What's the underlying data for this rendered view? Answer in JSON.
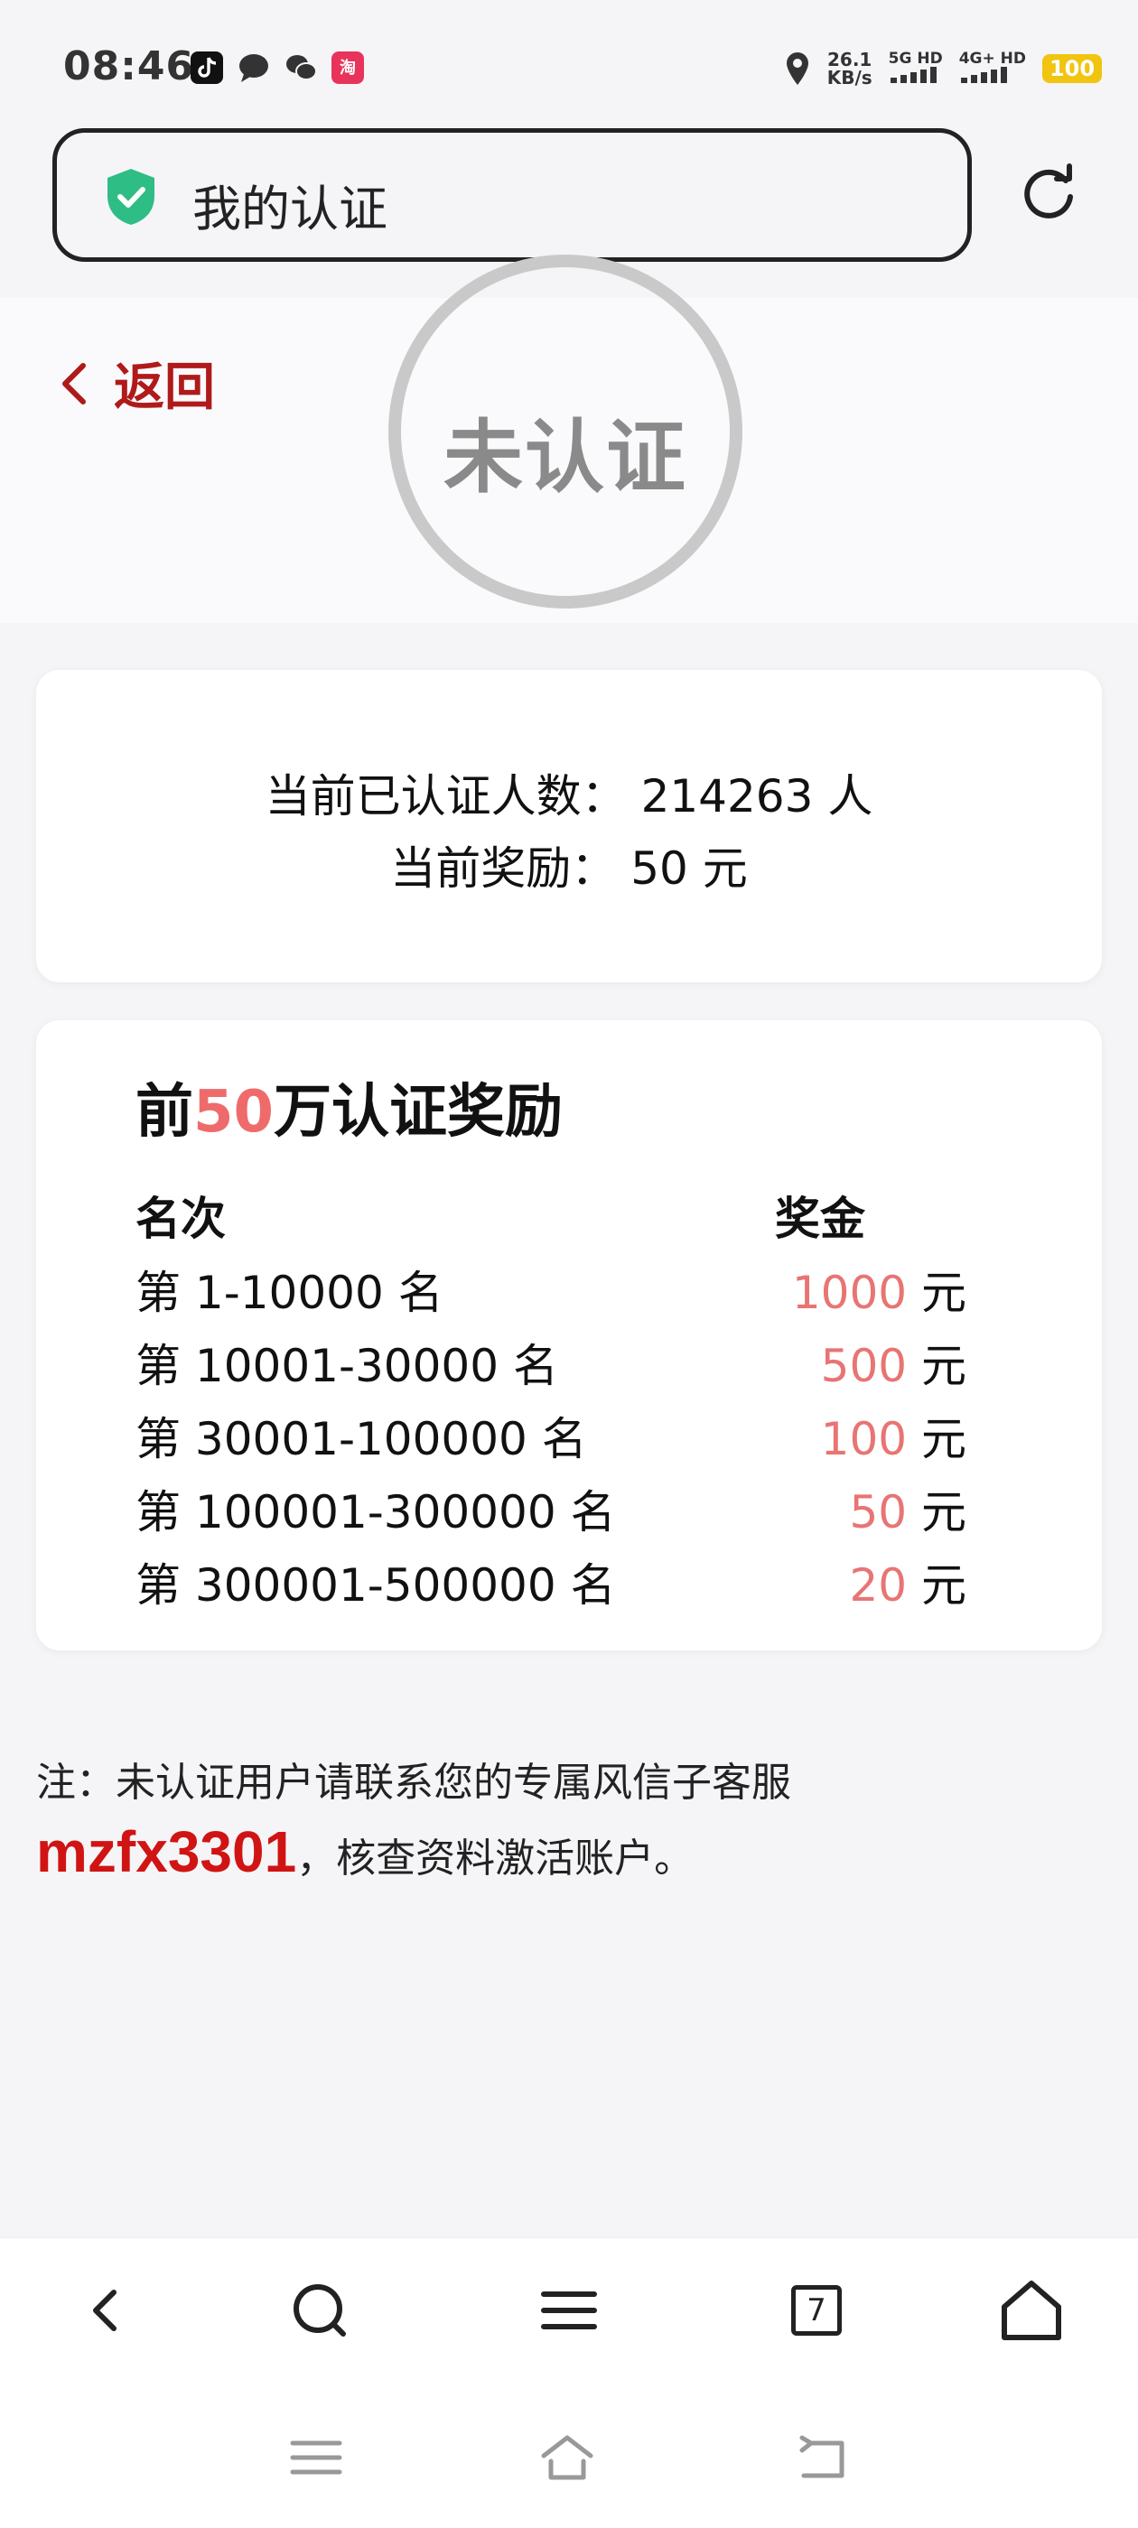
{
  "status_bar": {
    "time": "08:46",
    "net_speed_value": "26.1",
    "net_speed_unit": "KB/s",
    "sim1": "5G HD",
    "sim2": "4G+ HD",
    "battery": "100",
    "icons": [
      "tiktok-icon",
      "message-icon",
      "wechat-icon",
      "taobao-icon",
      "location-icon"
    ]
  },
  "address_bar": {
    "title": "我的认证",
    "security_icon": "shield-check-icon",
    "shield_color": "#2ebd85"
  },
  "header": {
    "back_label": "返回",
    "stamp_text": "未认证"
  },
  "stats": {
    "verified_label": "当前已认证人数：",
    "verified_count": "214263",
    "verified_unit": "人",
    "reward_label": "当前奖励：",
    "reward_amount": "50",
    "reward_unit": "元"
  },
  "reward_table": {
    "title_prefix": "前",
    "title_highlight": "50",
    "title_suffix": "万认证奖励",
    "col_rank": "名次",
    "col_prize": "奖金",
    "rows": [
      {
        "rank": "第 1-10000 名",
        "amount": "1000",
        "unit": "元"
      },
      {
        "rank": "第 10001-30000 名",
        "amount": "500",
        "unit": "元"
      },
      {
        "rank": "第 30001-100000 名",
        "amount": "100",
        "unit": "元"
      },
      {
        "rank": "第 100001-300000 名",
        "amount": "50",
        "unit": "元"
      },
      {
        "rank": "第 300001-500000 名",
        "amount": "20",
        "unit": "元"
      }
    ]
  },
  "note": {
    "line1": "注：未认证用户请联系您的专属风信子客服",
    "contact_id": "mzfx3301",
    "line2_suffix": "，核查资料激活账户。"
  },
  "toolbar": {
    "tab_count": "7",
    "icons": [
      "back-icon",
      "search-icon",
      "menu-icon",
      "tabs-icon",
      "home-icon"
    ]
  },
  "colors": {
    "accent_red": "#b01a1a",
    "highlight": "#ef6b6b",
    "contact_red": "#d01414"
  }
}
